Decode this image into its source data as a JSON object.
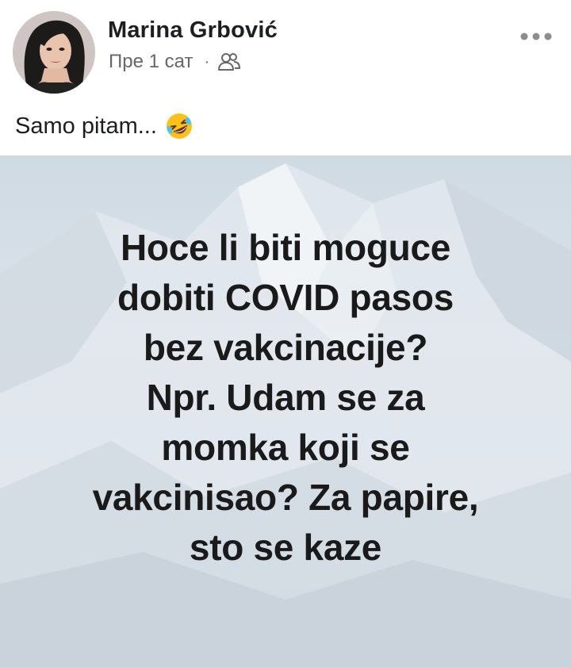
{
  "post": {
    "author": "Marina Grbović",
    "time": "Пре 1 сат",
    "separator": "·",
    "audience_icon": "friends-icon",
    "more_icon": "more-options-icon",
    "text": "Samo pitam...",
    "emoji": "rolling-on-floor-laughing-emoji"
  },
  "image": {
    "lines": [
      "Hoce li biti moguce",
      "dobiti COVID pasos",
      "bez vakcinacije?",
      "Npr. Udam se za",
      "momka koji se",
      "vakcinisao? Za papire,",
      "sto se kaze"
    ]
  },
  "colors": {
    "name": "#1c1e21",
    "meta": "#65676b",
    "meme_text": "#1a1a1a"
  }
}
